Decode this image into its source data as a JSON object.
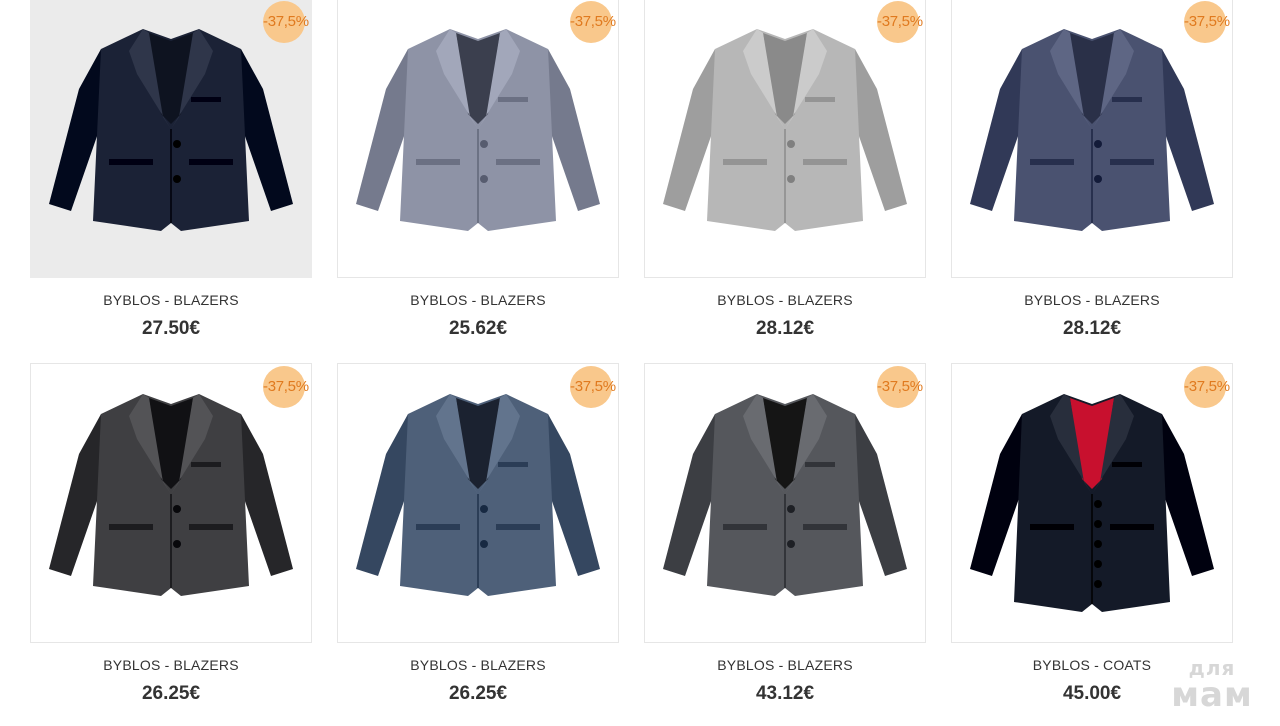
{
  "products": [
    {
      "brand": "BYBLOS - BLAZERS",
      "price": "27.50€",
      "discount": "-37,5%",
      "jacket_color": "#1b2236",
      "lining_color": "#0e1320",
      "image": "navy-blazer-icon",
      "shaded": true
    },
    {
      "brand": "BYBLOS - BLAZERS",
      "price": "25.62€",
      "discount": "-37,5%",
      "jacket_color": "#8e93a6",
      "lining_color": "#3b3f4e",
      "image": "houndstooth-blazer-icon",
      "shaded": false
    },
    {
      "brand": "BYBLOS - BLAZERS",
      "price": "28.12€",
      "discount": "-37,5%",
      "jacket_color": "#b7b7b7",
      "lining_color": "#8a8a8a",
      "image": "light-check-blazer-icon",
      "shaded": false
    },
    {
      "brand": "BYBLOS - BLAZERS",
      "price": "28.12€",
      "discount": "-37,5%",
      "jacket_color": "#4a5270",
      "lining_color": "#2a3048",
      "image": "blue-check-blazer-icon",
      "shaded": false
    },
    {
      "brand": "BYBLOS - BLAZERS",
      "price": "26.25€",
      "discount": "-37,5%",
      "jacket_color": "#3f3f42",
      "lining_color": "#111114",
      "image": "charcoal-blazer-icon",
      "shaded": false
    },
    {
      "brand": "BYBLOS - BLAZERS",
      "price": "26.25€",
      "discount": "-37,5%",
      "jacket_color": "#4e6079",
      "lining_color": "#1b2230",
      "image": "denim-blazer-icon",
      "shaded": false
    },
    {
      "brand": "BYBLOS - BLAZERS",
      "price": "43.12€",
      "discount": "-37,5%",
      "jacket_color": "#55575c",
      "lining_color": "#151515",
      "image": "grey-blazer-icon",
      "shaded": false
    },
    {
      "brand": "BYBLOS - COATS",
      "price": "45.00€",
      "discount": "-37,5%",
      "jacket_color": "#141a28",
      "lining_color": "#c8102e",
      "image": "navy-coat-icon",
      "shaded": false
    }
  ],
  "watermark": {
    "line1": "для",
    "line2": "мам"
  },
  "colors": {
    "badge_bg": "#f9c88c",
    "badge_text": "#e07a1f",
    "text": "#333333"
  }
}
